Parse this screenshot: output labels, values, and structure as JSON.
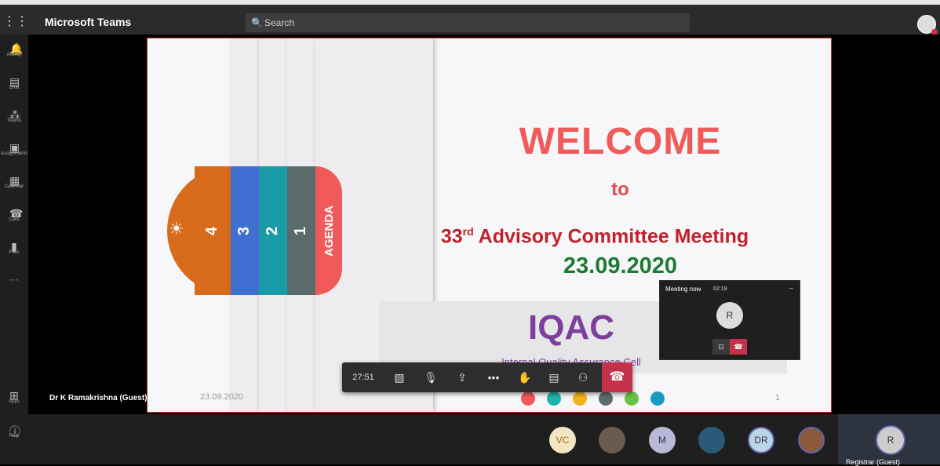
{
  "app": {
    "title": "Microsoft Teams"
  },
  "search": {
    "label": "Search"
  },
  "rail": [
    {
      "label": "Activity",
      "icon": "bell-icon"
    },
    {
      "label": "Chat",
      "icon": "chat-icon"
    },
    {
      "label": "Teams",
      "icon": "teams-icon"
    },
    {
      "label": "Assignments",
      "icon": "assignments-icon"
    },
    {
      "label": "Calendar",
      "icon": "calendar-icon"
    },
    {
      "label": "Calls",
      "icon": "phone-icon"
    },
    {
      "label": "Files",
      "icon": "file-icon"
    },
    {
      "label": "Apps",
      "icon": "apps-icon"
    },
    {
      "label": "Help",
      "icon": "help-icon"
    }
  ],
  "slide": {
    "welcome": "WELCOME",
    "to": "to",
    "meeting_num": "33",
    "meeting_sup": "rd",
    "meeting_rest": " Advisory Committee Meeting",
    "date": "23.09.2020",
    "iqac": "IQAC",
    "cell": "Internal Quality Assurance Cell",
    "footer_date": "23.09.2020",
    "page_number": "1",
    "tabs": [
      "4",
      "3",
      "2",
      "1",
      "AGENDA"
    ],
    "colors": {
      "tab4": "#d86a1b",
      "tab3": "#3f6fd1",
      "tab2": "#1b9aa8",
      "tab1": "#5b6b6b",
      "agenda": "#f05a5a"
    },
    "dots": [
      "#f05a5a",
      "#1bb3a8",
      "#f2b31d",
      "#5b6b6b",
      "#6bc046",
      "#1b9ac0"
    ]
  },
  "presenter": {
    "name": "Dr K Ramakrishna (Guest)"
  },
  "toolbar": {
    "timer": "27:51"
  },
  "pip": {
    "title": "Meeting now",
    "time": "02:19",
    "avatar": "R"
  },
  "participants": [
    {
      "initials": "VC",
      "kind": "initials"
    },
    {
      "initials": "",
      "kind": "photo"
    },
    {
      "initials": "M",
      "kind": "initials"
    },
    {
      "initials": "",
      "kind": "photo"
    },
    {
      "initials": "DR",
      "kind": "initials"
    },
    {
      "initials": "",
      "kind": "photo"
    }
  ],
  "self": {
    "initials": "R",
    "name": "Registrar (Guest)"
  }
}
